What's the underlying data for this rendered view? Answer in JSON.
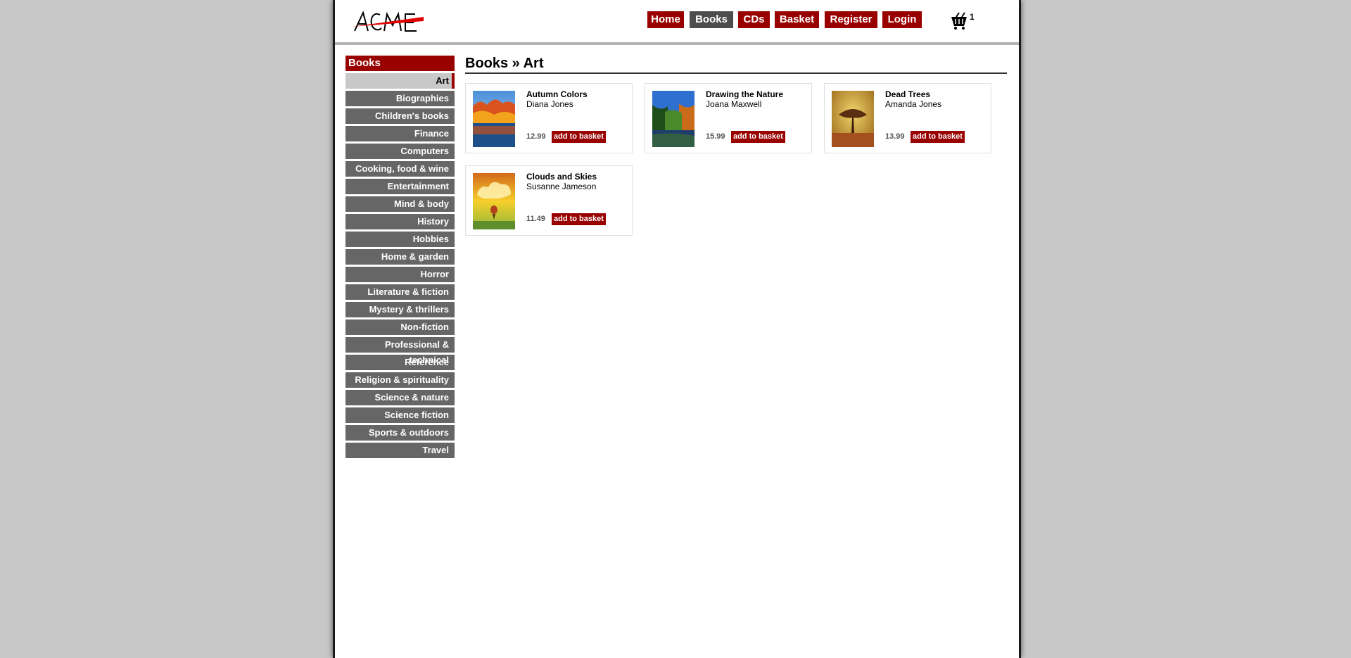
{
  "logo": {
    "text": "ACME"
  },
  "nav": [
    "Home",
    "Books",
    "CDs",
    "Basket",
    "Register",
    "Login"
  ],
  "cart": {
    "count": "1"
  },
  "sidebar": {
    "heading": "Books",
    "categories": [
      "Art",
      "Biographies",
      "Children's books",
      "Finance",
      "Computers",
      "Cooking, food & wine",
      "Entertainment",
      "Mind & body",
      "History",
      "Hobbies",
      "Home & garden",
      "Horror",
      "Literature & fiction",
      "Mystery & thrillers",
      "Non-fiction",
      "Professional & technical",
      "Reference",
      "Religion & spirituality",
      "Science & nature",
      "Science fiction",
      "Sports & outdoors",
      "Travel"
    ]
  },
  "breadcrumb": "Books » Art",
  "products": [
    {
      "title": "Autumn Colors",
      "author": "Diana Jones",
      "price": "12.99",
      "button": "add to basket"
    },
    {
      "title": "Drawing the Nature",
      "author": "Joana Maxwell",
      "price": "15.99",
      "button": "add to basket"
    },
    {
      "title": "Dead Trees",
      "author": "Amanda Jones",
      "price": "13.99",
      "button": "add to basket"
    },
    {
      "title": "Clouds and Skies",
      "author": "Susanne Jameson",
      "price": "11.49",
      "button": "add to basket"
    }
  ],
  "colors": {
    "accent": "#990000",
    "active_nav": "#4d4d4d",
    "category_bg": "#666666"
  }
}
